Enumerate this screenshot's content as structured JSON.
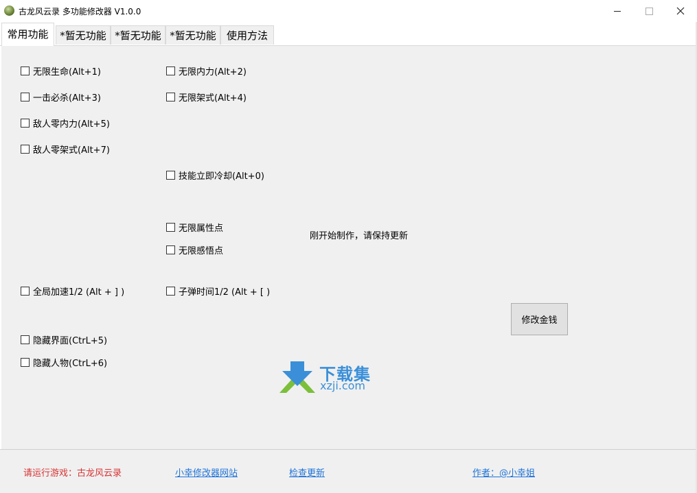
{
  "window": {
    "title": "古龙风云录 多功能修改器  V1.0.0"
  },
  "tabs": [
    {
      "label": "常用功能",
      "active": true
    },
    {
      "label": "*暂无功能",
      "active": false
    },
    {
      "label": "*暂无功能",
      "active": false
    },
    {
      "label": "*暂无功能",
      "active": false
    },
    {
      "label": "使用方法",
      "active": false
    }
  ],
  "options": {
    "infinite_hp": {
      "label": "无限生命(Alt+1)",
      "checked": false
    },
    "infinite_mp": {
      "label": "无限内力(Alt+2)",
      "checked": false
    },
    "one_hit_kill": {
      "label": "一击必杀(Alt+3)",
      "checked": false
    },
    "infinite_stance": {
      "label": "无限架式(Alt+4)",
      "checked": false
    },
    "enemy_zero_mp": {
      "label": "敌人零内力(Alt+5)",
      "checked": false
    },
    "enemy_zero_stance": {
      "label": "敌人零架式(Alt+7)",
      "checked": false
    },
    "instant_cooldown": {
      "label": "技能立即冷却(Alt+0)",
      "checked": false
    },
    "infinite_attr_points": {
      "label": "无限属性点",
      "checked": false
    },
    "infinite_insight_points": {
      "label": "无限感悟点",
      "checked": false
    },
    "global_speed": {
      "label": "全局加速1/2 (Alt + ] )",
      "checked": false
    },
    "bullet_time": {
      "label": "子弹时间1/2 (Alt + [ )",
      "checked": false
    },
    "hide_ui": {
      "label": "隐藏界面(CtrL+5)",
      "checked": false
    },
    "hide_character": {
      "label": "隐藏人物(CtrL+6)",
      "checked": false
    }
  },
  "notice": "刚开始制作，请保持更新",
  "money_button": "修改金钱",
  "watermark": {
    "cn": "下载集",
    "en": "xzji.com"
  },
  "footer": {
    "status": "请运行游戏：古龙风云录",
    "website_link": "小幸修改器网站",
    "update_link": "检查更新",
    "author_link": "作者：@小幸姐"
  },
  "colors": {
    "status_red": "#d83232",
    "link_blue": "#1e73d8",
    "panel_bg": "#f0f0f0",
    "watermark_blue": "#3a8fd8",
    "watermark_green": "#7cbf3a"
  }
}
